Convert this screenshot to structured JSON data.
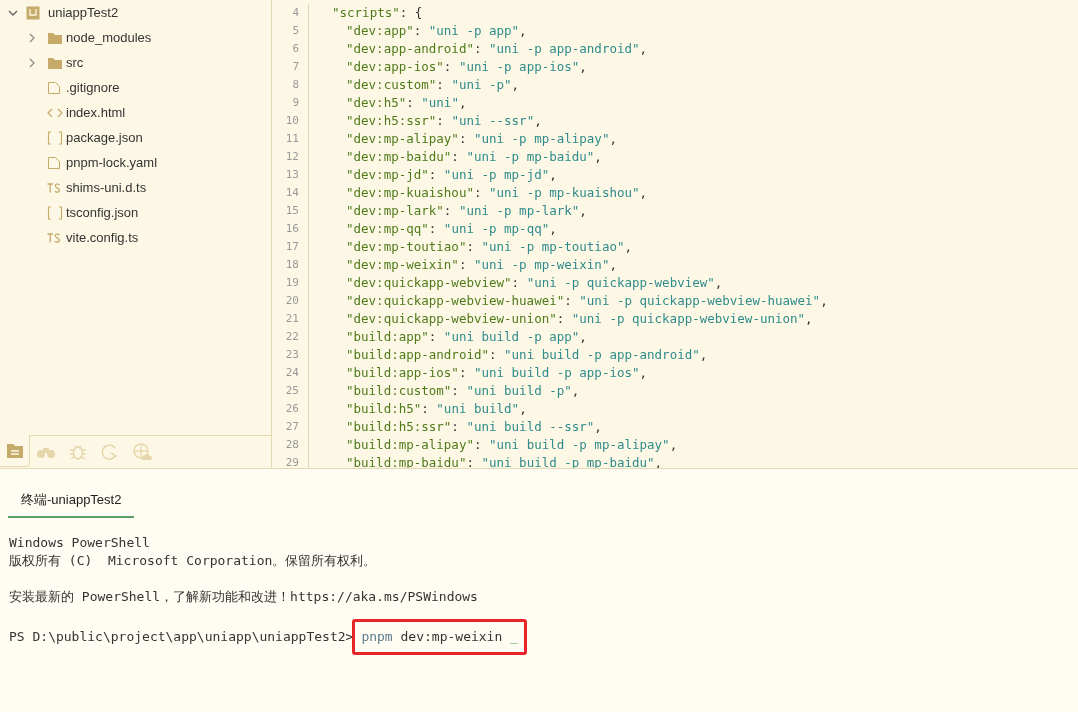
{
  "explorer": {
    "root": {
      "label": "uniappTest2",
      "expanded": true,
      "children": [
        {
          "label": "node_modules",
          "kind": "folder",
          "expanded": false
        },
        {
          "label": "src",
          "kind": "folder",
          "expanded": false
        },
        {
          "label": ".gitignore",
          "kind": "file"
        },
        {
          "label": "index.html",
          "kind": "html"
        },
        {
          "label": "package.json",
          "kind": "json"
        },
        {
          "label": "pnpm-lock.yaml",
          "kind": "file"
        },
        {
          "label": "shims-uni.d.ts",
          "kind": "ts"
        },
        {
          "label": "tsconfig.json",
          "kind": "json"
        },
        {
          "label": "vite.config.ts",
          "kind": "ts"
        }
      ]
    }
  },
  "sidebar_tabs": [
    {
      "kind": "files",
      "selected": true
    },
    {
      "kind": "binoculars",
      "selected": false
    },
    {
      "kind": "bug",
      "selected": false
    },
    {
      "kind": "refresh",
      "selected": false
    },
    {
      "kind": "globe",
      "selected": false
    }
  ],
  "editor": {
    "lines": [
      {
        "number": "4",
        "kind": "object",
        "key": "\"scripts\"",
        "sep": ": ",
        "value": "{"
      },
      {
        "number": "5",
        "kind": "pair",
        "key": "\"dev:app\"",
        "sep": ": ",
        "value": "\"uni -p app\"",
        "end": ","
      },
      {
        "number": "6",
        "kind": "pair",
        "key": "\"dev:app-android\"",
        "sep": ": ",
        "value": "\"uni -p app-android\"",
        "end": ","
      },
      {
        "number": "7",
        "kind": "pair",
        "key": "\"dev:app-ios\"",
        "sep": ": ",
        "value": "\"uni -p app-ios\"",
        "end": ","
      },
      {
        "number": "8",
        "kind": "pair",
        "key": "\"dev:custom\"",
        "sep": ": ",
        "value": "\"uni -p\"",
        "end": ","
      },
      {
        "number": "9",
        "kind": "pair",
        "key": "\"dev:h5\"",
        "sep": ": ",
        "value": "\"uni\"",
        "end": ","
      },
      {
        "number": "10",
        "kind": "pair",
        "key": "\"dev:h5:ssr\"",
        "sep": ": ",
        "value": "\"uni --ssr\"",
        "end": ","
      },
      {
        "number": "11",
        "kind": "pair",
        "key": "\"dev:mp-alipay\"",
        "sep": ": ",
        "value": "\"uni -p mp-alipay\"",
        "end": ","
      },
      {
        "number": "12",
        "kind": "pair",
        "key": "\"dev:mp-baidu\"",
        "sep": ": ",
        "value": "\"uni -p mp-baidu\"",
        "end": ","
      },
      {
        "number": "13",
        "kind": "pair",
        "key": "\"dev:mp-jd\"",
        "sep": ": ",
        "value": "\"uni -p mp-jd\"",
        "end": ","
      },
      {
        "number": "14",
        "kind": "pair",
        "key": "\"dev:mp-kuaishou\"",
        "sep": ": ",
        "value": "\"uni -p mp-kuaishou\"",
        "end": ","
      },
      {
        "number": "15",
        "kind": "pair",
        "key": "\"dev:mp-lark\"",
        "sep": ": ",
        "value": "\"uni -p mp-lark\"",
        "end": ","
      },
      {
        "number": "16",
        "kind": "pair",
        "key": "\"dev:mp-qq\"",
        "sep": ": ",
        "value": "\"uni -p mp-qq\"",
        "end": ","
      },
      {
        "number": "17",
        "kind": "pair",
        "key": "\"dev:mp-toutiao\"",
        "sep": ": ",
        "value": "\"uni -p mp-toutiao\"",
        "end": ","
      },
      {
        "number": "18",
        "kind": "pair",
        "key": "\"dev:mp-weixin\"",
        "sep": ": ",
        "value": "\"uni -p mp-weixin\"",
        "end": ","
      },
      {
        "number": "19",
        "kind": "pair",
        "key": "\"dev:quickapp-webview\"",
        "sep": ": ",
        "value": "\"uni -p quickapp-webview\"",
        "end": ","
      },
      {
        "number": "20",
        "kind": "pair",
        "key": "\"dev:quickapp-webview-huawei\"",
        "sep": ": ",
        "value": "\"uni -p quickapp-webview-huawei\"",
        "end": ","
      },
      {
        "number": "21",
        "kind": "pair",
        "key": "\"dev:quickapp-webview-union\"",
        "sep": ": ",
        "value": "\"uni -p quickapp-webview-union\"",
        "end": ","
      },
      {
        "number": "22",
        "kind": "pair",
        "key": "\"build:app\"",
        "sep": ": ",
        "value": "\"uni build -p app\"",
        "end": ","
      },
      {
        "number": "23",
        "kind": "pair",
        "key": "\"build:app-android\"",
        "sep": ": ",
        "value": "\"uni build -p app-android\"",
        "end": ","
      },
      {
        "number": "24",
        "kind": "pair",
        "key": "\"build:app-ios\"",
        "sep": ": ",
        "value": "\"uni build -p app-ios\"",
        "end": ","
      },
      {
        "number": "25",
        "kind": "pair",
        "key": "\"build:custom\"",
        "sep": ": ",
        "value": "\"uni build -p\"",
        "end": ","
      },
      {
        "number": "26",
        "kind": "pair",
        "key": "\"build:h5\"",
        "sep": ": ",
        "value": "\"uni build\"",
        "end": ","
      },
      {
        "number": "27",
        "kind": "pair",
        "key": "\"build:h5:ssr\"",
        "sep": ": ",
        "value": "\"uni build --ssr\"",
        "end": ","
      },
      {
        "number": "28",
        "kind": "pair",
        "key": "\"build:mp-alipay\"",
        "sep": ": ",
        "value": "\"uni build -p mp-alipay\"",
        "end": ","
      },
      {
        "number": "29",
        "kind": "pair",
        "key": "\"build:mp-baidu\"",
        "sep": ": ",
        "value": "\"uni build -p mp-baidu\"",
        "end": ","
      }
    ]
  },
  "terminal": {
    "tabs": [
      {
        "label": "终端-uniappTest2",
        "selected": true
      }
    ],
    "lines": [
      {
        "kind": "output",
        "text": "Windows PowerShell"
      },
      {
        "kind": "output",
        "text": "版权所有 (C)  Microsoft Corporation。保留所有权利。"
      },
      {
        "kind": "blank"
      },
      {
        "kind": "output",
        "text": "安装最新的 PowerShell，了解新功能和改进！https://aka.ms/PSWindows"
      },
      {
        "kind": "blank"
      },
      {
        "kind": "prompt",
        "prompt": "PS D:\\public\\project\\app\\uniapp\\uniappTest2>",
        "program": "pnpm",
        "args": "dev:mp-weixin",
        "cursor": "_",
        "highlighted": true
      }
    ]
  }
}
